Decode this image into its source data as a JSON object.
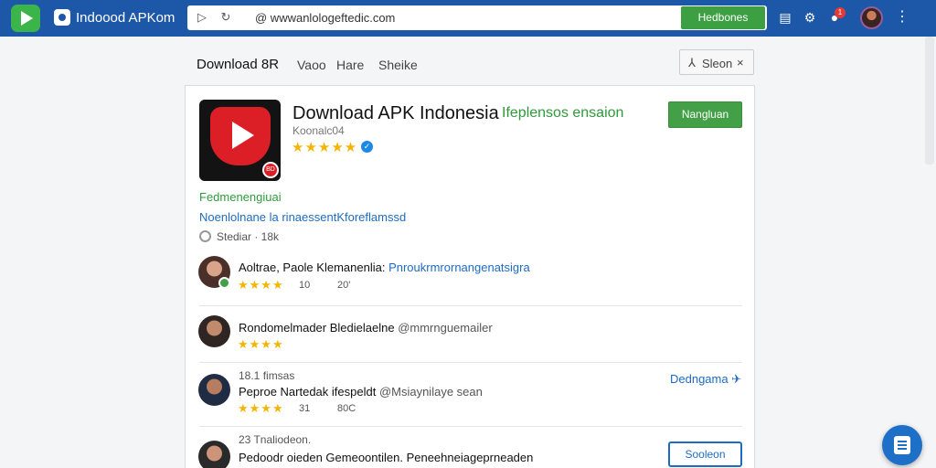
{
  "topbar": {
    "brand": "Indoood APKom",
    "url": "@ wwwanlologeftedic.com",
    "url_button": "Hedbones",
    "badge_count": "1"
  },
  "subnav": {
    "title": "Download 8R",
    "links": [
      "Vaoo",
      "Hare",
      "Sheike"
    ],
    "search": "Sleon"
  },
  "app": {
    "title": "Download APK Indonesia",
    "tagline": "Ifeplensos ensaion",
    "developer": "Koonalc04",
    "rating_stars": "★★★★★",
    "install_label": "Nangluan",
    "icon_badge": "BD",
    "category": "Fedmenengiuai",
    "description": "Noenlolnane la rinaessentKforeflamssd",
    "stats": "Stediar · 18k"
  },
  "reviews": [
    {
      "name": "Aoltrae, Paole",
      "highlight": "Klemanenlia:",
      "tag": "Pnroukrmrornangenatsigra",
      "stars": "★★★★",
      "meta1": "10",
      "meta2": "20'"
    },
    {
      "name": "Rondomelmader Bledielaelne",
      "handle": "@mmrnguemailer",
      "stars": "★★★★"
    },
    {
      "date": "18.1 fimsas",
      "name": "Peproe Nartedak ifespeldt",
      "handle": "@Msiaynilaye sean",
      "stars": "★★★★",
      "meta1": "31",
      "meta2": "80C",
      "action": "Dedngama"
    },
    {
      "date": "23 Tnaliodeon.",
      "name": "Pedoodr oieden Gemeoontilen. Peneehneiageprneaden",
      "action": "Sooleon"
    }
  ],
  "colors": {
    "topbar": "#1d58a8",
    "green": "#43a047",
    "link_blue": "#1d6bc2",
    "star": "#f5b400",
    "app_red": "#dc1f26"
  }
}
